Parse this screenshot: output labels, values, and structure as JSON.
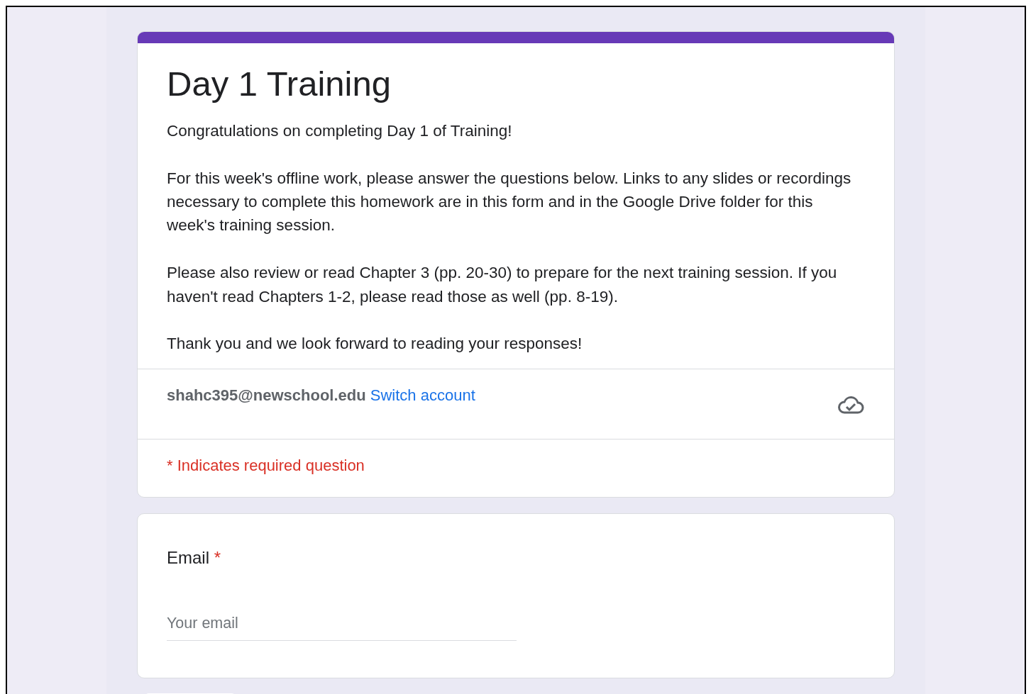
{
  "form": {
    "title": "Day 1 Training",
    "description": [
      "Congratulations on completing Day 1 of Training!",
      "For this week's offline work, please answer the questions below. Links to any slides or recordings necessary to complete this homework are in this form and in the Google Drive folder for this week's training session.",
      "Please also review or read Chapter 3 (pp. 20-30) to prepare for the next training session. If you haven't read Chapters 1-2, please read those as well (pp. 8-19).",
      "Thank you and we look forward to reading your responses!"
    ],
    "account": {
      "email": "shahc395@newschool.edu",
      "switch_link": "Switch account"
    },
    "required_note": "* Indicates required question"
  },
  "questions": [
    {
      "kind": "short_text",
      "label": "Email",
      "required": true,
      "required_mark": "*",
      "placeholder": "Your email"
    }
  ]
}
